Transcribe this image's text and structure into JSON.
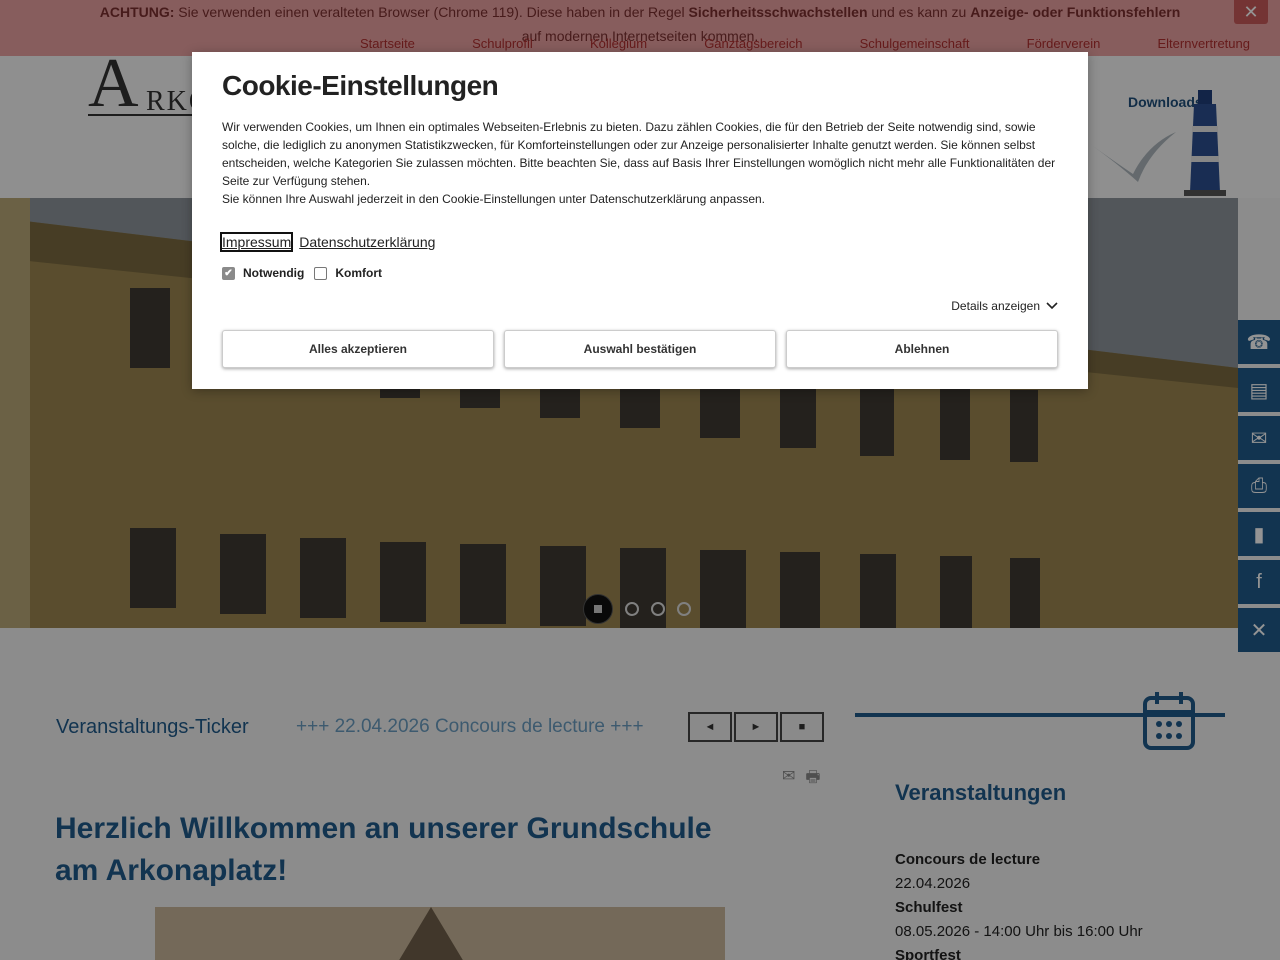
{
  "warning": {
    "label": "ACHTUNG:",
    "text1": " Sie verwenden einen veralteten Browser (Chrome 119). Diese haben in der Regel ",
    "bold1": "Sicherheitsschwachstellen",
    "text2": " und es kann zu ",
    "bold2": "Anzeige- oder Funktionsfehlern",
    "text3": " auf modernen Internetseiten kommen.",
    "close": "✕"
  },
  "nav": {
    "items": [
      "Startseite",
      "Schulprofil",
      "Kollegium",
      "Ganztagsbereich",
      "Schulgemeinschaft",
      "Förderverein",
      "Elternvertretung"
    ]
  },
  "logo": {
    "letter": "A",
    "rest": "RKO"
  },
  "header": {
    "downloads": "Downloads"
  },
  "ticker": {
    "title": "Veranstaltungs-Ticker",
    "text": "+++  22.04.2026 Concours de lecture +++",
    "prev": "◄",
    "next": "►",
    "stop": "■"
  },
  "tools": {
    "mail": "✉",
    "print": "🖶"
  },
  "welcome": {
    "title": "Herzlich Willkommen an unserer Grundschule am Arkonaplatz!"
  },
  "events": {
    "heading": "Veranstaltungen",
    "items": [
      {
        "title": "Concours de lecture",
        "date": "22.04.2026"
      },
      {
        "title": "Schulfest",
        "date": "08.05.2026 - 14:00 Uhr bis 16:00 Uhr"
      },
      {
        "title": "Sportfest",
        "date": ""
      }
    ]
  },
  "side_icons": [
    "contact-card-icon",
    "address-card-icon",
    "mail-icon",
    "print-icon",
    "bookmark-icon",
    "facebook-icon",
    "x-icon"
  ],
  "cookie": {
    "title": "Cookie-Einstellungen",
    "body1": "Wir verwenden Cookies, um Ihnen ein optimales Webseiten-Erlebnis zu bieten. Dazu zählen Cookies, die für den Betrieb der Seite notwendig sind, sowie solche, die lediglich zu anonymen Statistikzwecken, für Komforteinstellungen oder zur Anzeige personalisierter Inhalte genutzt werden. Sie können selbst entscheiden, welche Kategorien Sie zulassen möchten. Bitte beachten Sie, dass auf Basis Ihrer Einstellungen womöglich nicht mehr alle Funktionalitäten der Seite zur Verfügung stehen.",
    "body2": "Sie können Ihre Auswahl jederzeit in den Cookie-Einstellungen unter Datenschutzerklärung anpassen.",
    "link_impressum": "Impressum",
    "link_privacy": "Datenschutzerklärung",
    "check_necessary": "Notwendig",
    "check_comfort": "Komfort",
    "details": "Details anzeigen",
    "btn_accept_all": "Alles akzeptieren",
    "btn_confirm": "Auswahl bestätigen",
    "btn_reject": "Ablehnen"
  },
  "colors": {
    "brand_blue": "#1f5a8a",
    "warning_bg": "#e8a0a0"
  }
}
